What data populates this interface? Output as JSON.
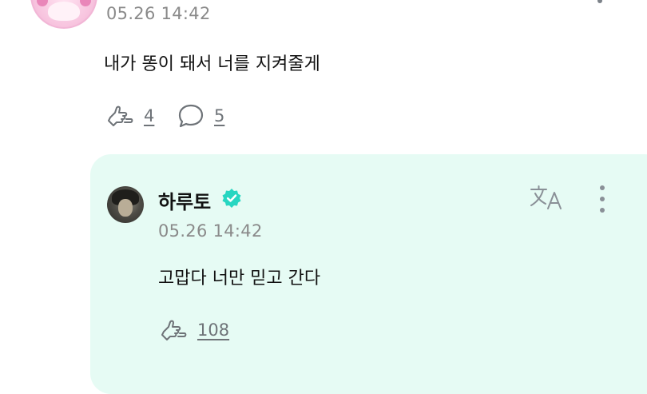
{
  "fan_post": {
    "timestamp": "05.26 14:42",
    "message": "내가 똥이 돼서 너를 지켜줄게",
    "reactions": {
      "like_count": "4",
      "comment_count": "5"
    }
  },
  "artist_reply": {
    "name": "하루토",
    "verified": true,
    "timestamp": "05.26 14:42",
    "message": "고맙다 너만 믿고 간다",
    "reactions": {
      "like_count": "108"
    }
  },
  "icons": {
    "like": "heart-hands-outline-icon",
    "comment": "speech-bubble-icon",
    "translate": "translate-icon",
    "more": "kebab-menu-icon",
    "verified": "verified-badge-icon"
  },
  "colors": {
    "card_background": "#e6fbf4",
    "verified_badge": "#27d6c1",
    "timestamp": "#8a8a8a",
    "icon_gray": "#7c8289"
  }
}
